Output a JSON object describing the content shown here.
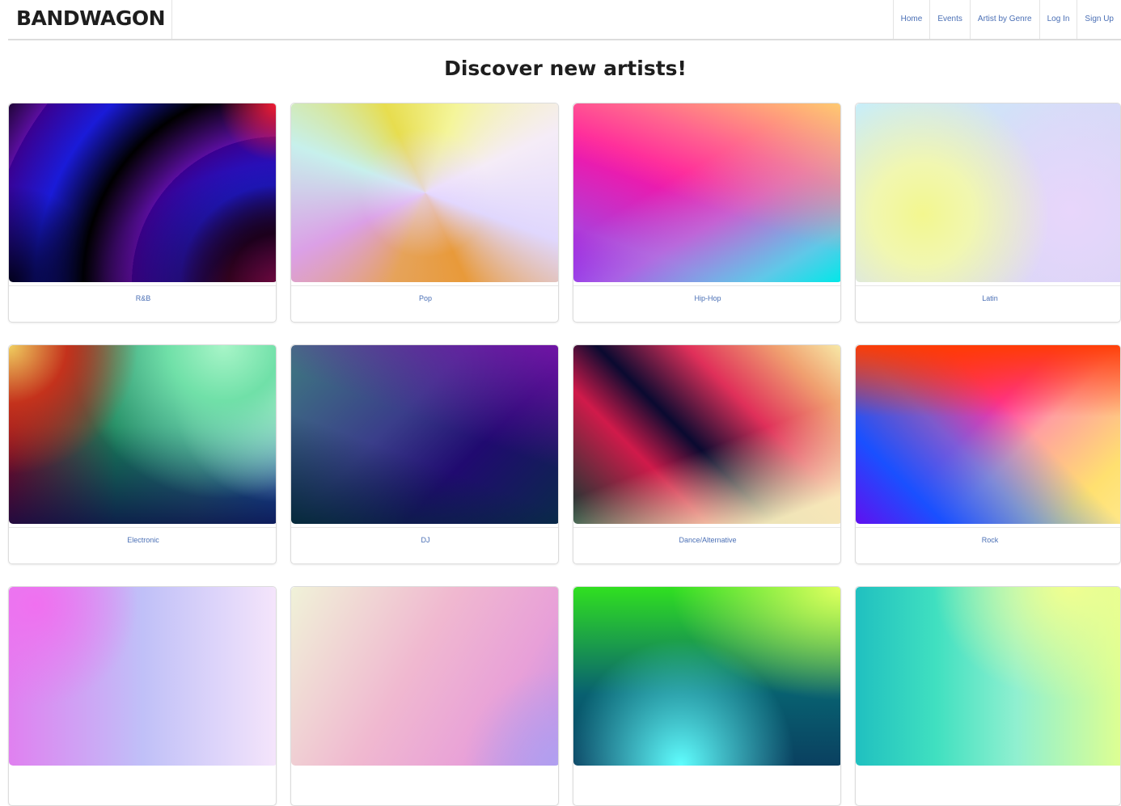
{
  "navbar": {
    "brand": "BANDWAGON",
    "links": [
      {
        "label": "Home"
      },
      {
        "label": "Events"
      },
      {
        "label": "Artist by Genre"
      },
      {
        "label": "Log In"
      },
      {
        "label": "Sign Up"
      }
    ]
  },
  "main": {
    "title": "Discover new artists!",
    "genres": [
      {
        "label": "R&B"
      },
      {
        "label": "Pop"
      },
      {
        "label": "Hip-Hop"
      },
      {
        "label": "Latin"
      },
      {
        "label": "Electronic"
      },
      {
        "label": "DJ"
      },
      {
        "label": "Dance/Alternative"
      },
      {
        "label": "Rock"
      }
    ]
  },
  "colors": {
    "link": "#4a6fb5",
    "heading": "#1e1e1e",
    "border": "#dcdcdc"
  }
}
